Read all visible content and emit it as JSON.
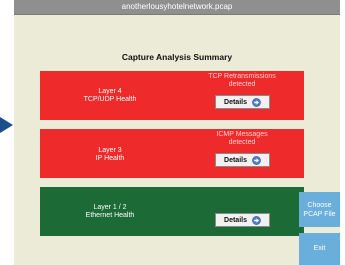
{
  "window": {
    "title": "anotherlousyhotelnetwork.pcap"
  },
  "summary": {
    "heading": "Capture Analysis Summary"
  },
  "panels": [
    {
      "name_line1": "Layer 4",
      "name_line2": "TCP/UDP Health",
      "status_line1": "TCP Retransmissions",
      "status_line2": "detected",
      "button_label": "Details",
      "color": "#ee2a2a",
      "state": "error"
    },
    {
      "name_line1": "Layer 3",
      "name_line2": "IP Health",
      "status_line1": "ICMP Messages",
      "status_line2": "detected",
      "button_label": "Details",
      "color": "#ee2a2a",
      "state": "error"
    },
    {
      "name_line1": "Layer 1 / 2",
      "name_line2": "Ethernet Health",
      "status_line1": "",
      "status_line2": "",
      "button_label": "Details",
      "color": "#1c6b36",
      "state": "ok"
    }
  ],
  "sidebar": {
    "choose_line1": "Choose",
    "choose_line2": "PCAP File",
    "exit_label": "Exit",
    "accent": "#6aaedb"
  },
  "icons": {
    "details": "right-arrow-icon",
    "pointer": "pointer-triangle-icon"
  }
}
